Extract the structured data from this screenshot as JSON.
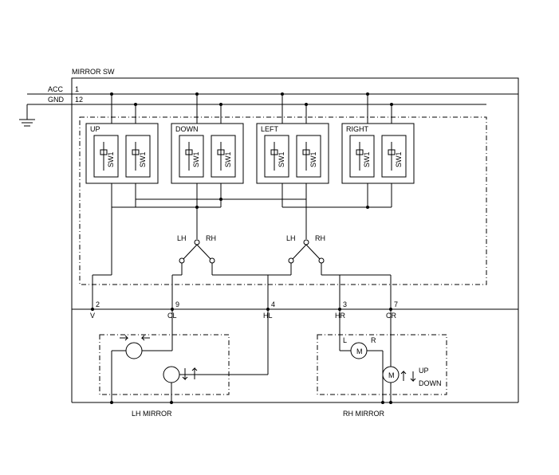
{
  "title": "MIRROR SW",
  "inputs": {
    "acc": {
      "label": "ACC",
      "pin": "1"
    },
    "gnd": {
      "label": "GND",
      "pin": "12"
    }
  },
  "direction_switches": [
    {
      "name": "UP",
      "left_sw": "SW1",
      "right_sw": "SW1"
    },
    {
      "name": "DOWN",
      "left_sw": "SW1",
      "right_sw": "SW1"
    },
    {
      "name": "LEFT",
      "left_sw": "SW1",
      "right_sw": "SW1"
    },
    {
      "name": "RIGHT",
      "left_sw": "SW1",
      "right_sw": "SW1"
    }
  ],
  "selectors": [
    {
      "lh": "LH",
      "rh": "RH"
    },
    {
      "lh": "LH",
      "rh": "RH"
    }
  ],
  "terminals": {
    "t2": {
      "pin": "2",
      "label": "V"
    },
    "t9": {
      "pin": "9",
      "label": "CL"
    },
    "t4": {
      "pin": "4",
      "label": "HL"
    },
    "t3": {
      "pin": "3",
      "label": "HR"
    },
    "t7": {
      "pin": "7",
      "label": "CR"
    }
  },
  "mirrors": {
    "lh": {
      "label": "LH MIRROR"
    },
    "rh": {
      "label": "RH MIRROR",
      "motor_lr": {
        "symbol": "M",
        "left": "L",
        "right": "R"
      },
      "motor_ud": {
        "symbol": "M",
        "up": "UP",
        "down": "DOWN"
      }
    }
  }
}
